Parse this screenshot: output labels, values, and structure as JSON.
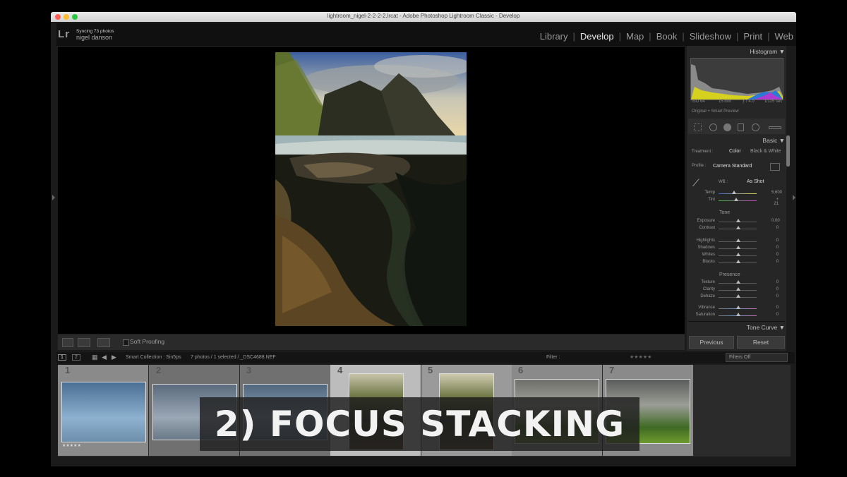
{
  "window": {
    "title": "lightroom_nigel-2-2-2-2.lrcat - Adobe Photoshop Lightroom Classic - Develop"
  },
  "identity": {
    "logo": "Lr",
    "sync_status": "Syncing 73 photos",
    "owner": "nigel danson"
  },
  "modules": [
    "Library",
    "Develop",
    "Map",
    "Book",
    "Slideshow",
    "Print",
    "Web"
  ],
  "active_module": "Develop",
  "toolbar": {
    "soft_proofing": "Soft Proofing"
  },
  "panel": {
    "histogram_title": "Histogram",
    "camera_info": {
      "iso": "ISO 64",
      "focal": "15 mm",
      "aperture": "ƒ / 4.0",
      "shutter": "1⁄125 sec"
    },
    "preview_mode": "Original + Smart Preview",
    "basic_title": "Basic",
    "treatment_label": "Treatment :",
    "treatment_color": "Color",
    "treatment_bw": "Black & White",
    "profile_label": "Profile :",
    "profile_value": "Camera Standard",
    "wb_label": "WB :",
    "wb_value": "As Shot",
    "temp": {
      "label": "Temp",
      "value": "5,600"
    },
    "tint": {
      "label": "Tint",
      "value": "+ 21"
    },
    "tone_title": "Tone",
    "tone_sliders": [
      {
        "label": "Exposure",
        "value": "0.00"
      },
      {
        "label": "Contrast",
        "value": "0"
      },
      {
        "label": "Highlights",
        "value": "0"
      },
      {
        "label": "Shadows",
        "value": "0"
      },
      {
        "label": "Whites",
        "value": "0"
      },
      {
        "label": "Blacks",
        "value": "0"
      }
    ],
    "presence_title": "Presence",
    "presence_sliders": [
      {
        "label": "Texture",
        "value": "0"
      },
      {
        "label": "Clarity",
        "value": "0"
      },
      {
        "label": "Dehaze",
        "value": "0"
      },
      {
        "label": "Vibrance",
        "value": "0"
      },
      {
        "label": "Saturation",
        "value": "0"
      }
    ],
    "tone_curve_title": "Tone Curve",
    "previous_label": "Previous",
    "reset_label": "Reset"
  },
  "filmstrip_bar": {
    "page1": "1",
    "page2": "2",
    "collection": "Smart Collection : Sin5ps",
    "selection": "7 photos / 1 selected / _DSC4688.NEF",
    "filter_label": "Filter :",
    "filter_value": "Filters Off"
  },
  "filmstrip": [
    {
      "num": "1",
      "stars": "★★★★★"
    },
    {
      "num": "2",
      "stars": ""
    },
    {
      "num": "3",
      "stars": ""
    },
    {
      "num": "4",
      "stars": ""
    },
    {
      "num": "5",
      "stars": ""
    },
    {
      "num": "6",
      "stars": ""
    },
    {
      "num": "7",
      "stars": ""
    }
  ],
  "overlay": {
    "text": "2) FOCUS STACKING"
  }
}
